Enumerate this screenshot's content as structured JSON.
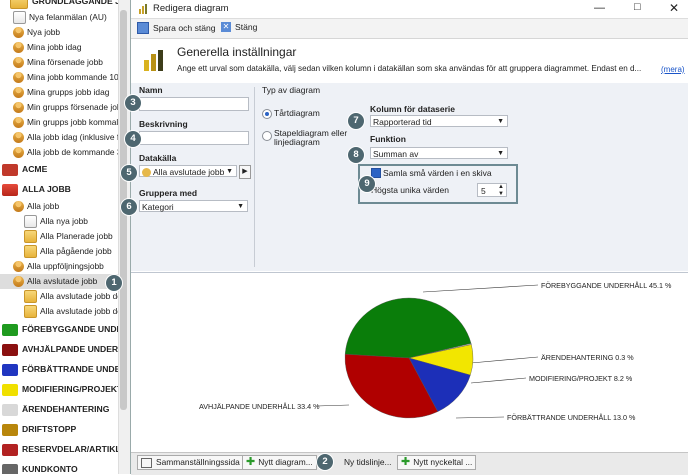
{
  "tree": {
    "top_group": "GRUNDLÄGGANDE JOBB",
    "items_top": [
      "Nya felanmälan (AU)",
      "Nya jobb",
      "Mina jobb idag",
      "Mina försenade jobb",
      "Mina jobb kommande 10",
      "Mina grupps jobb idag",
      "Min grupps försenade job",
      "Min grupps jobb kommal",
      "Alla jobb idag (inklusive f",
      "Alla jobb de kommande 3"
    ],
    "acme": "ACME",
    "alla_jobb_group": "ALLA JOBB",
    "alla_jobb": "Alla jobb",
    "alla_nya": "Alla nya jobb",
    "alla_planerade": "Alla Planerade jobb",
    "alla_pagaende": "Alla pågående jobb",
    "alla_uppfoljning": "Alla uppföljningsjobb",
    "alla_avslutade": "Alla avslutade jobb",
    "alla_avslutade_de1": "Alla avslutade jobb de",
    "alla_avslutade_de2": "Alla avslutade jobb de",
    "groups": [
      "FÖREBYGGANDE UNDERH",
      "AVHJÄLPANDE UNDERHÅ",
      "FÖRBÄTTRANDE UNDERH",
      "MODIFIERING/PROJEKT",
      "ÄRENDEHANTERING",
      "DRIFTSTOPP",
      "RESERVDELAR/ARTIKLAR",
      "KUNDKONTO"
    ]
  },
  "window": {
    "title": "Redigera diagram",
    "save_close": "Spara och stäng",
    "close": "Stäng",
    "header_title": "Generella inställningar",
    "header_desc": "Ange ett urval som datakälla, välj sedan vilken kolumn i datakällan som ska användas för att gruppera diagrammet. Endast en d...",
    "more": "(mera)"
  },
  "form": {
    "namn_label": "Namn",
    "beskrivning_label": "Beskrivning",
    "datakalla_label": "Datakälla",
    "datakalla_value": "Alla avslutade jobb",
    "gruppera_label": "Gruppera med",
    "gruppera_value": "Kategori",
    "typ_label": "Typ av diagram",
    "radio_pie": "Tårtdiagram",
    "radio_bar": "Stapeldiagram eller linjediagram",
    "kolumn_label": "Kolumn för dataserie",
    "kolumn_value": "Rapporterad tid",
    "funktion_label": "Funktion",
    "funktion_value": "Summan av",
    "samla_label": "Samla små värden i en skiva",
    "hogsta_label": "Högsta unika värden",
    "hogsta_value": "5"
  },
  "badges": [
    "1",
    "2",
    "3",
    "4",
    "5",
    "6",
    "7",
    "8",
    "9"
  ],
  "chart_data": {
    "type": "pie",
    "slices": [
      {
        "label": "FÖREBYGGANDE UNDERHÅLL 45.1 %",
        "value": 45.1,
        "color": "#0a7d0a"
      },
      {
        "label": "ÄRENDEHANTERING 0.3 %",
        "value": 0.3,
        "color": "#cfcfcf"
      },
      {
        "label": "MODIFIERING/PROJEKT 8.2 %",
        "value": 8.2,
        "color": "#f2e600"
      },
      {
        "label": "FÖRBÄTTRANDE UNDERHÅLL 13.0 %",
        "value": 13.0,
        "color": "#1c2fb8"
      },
      {
        "label": "AVHJÄLPANDE UNDERHÅLL 33.4 %",
        "value": 33.4,
        "color": "#b00000"
      }
    ]
  },
  "tabs": [
    "Sammanställningssida",
    "Nytt diagram...",
    "Ny tidslinje...",
    "Nytt nyckeltal ..."
  ]
}
